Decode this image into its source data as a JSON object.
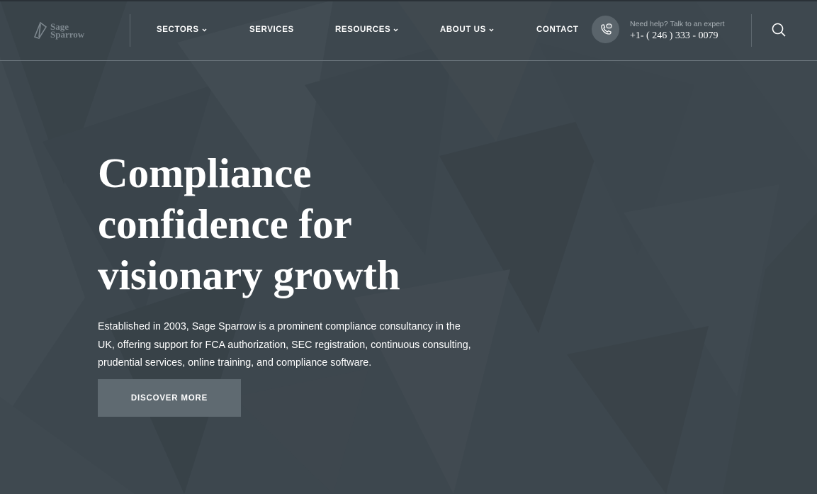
{
  "brand": {
    "line1": "Sage",
    "line2": "Sparrow"
  },
  "nav": {
    "items": [
      {
        "label": "SECTORS",
        "dropdown": true
      },
      {
        "label": "SERVICES",
        "dropdown": false
      },
      {
        "label": "RESOURCES",
        "dropdown": true
      },
      {
        "label": "ABOUT US",
        "dropdown": true
      },
      {
        "label": "CONTACT",
        "dropdown": false
      }
    ]
  },
  "help": {
    "label": "Need help? Talk to an expert",
    "phone": "+1- ( 246 ) 333 - 0079",
    "icon": "phone-chat-icon"
  },
  "search": {
    "icon": "search-icon"
  },
  "hero": {
    "title_lines": [
      "Compliance",
      "confidence for",
      "visionary growth"
    ],
    "description_lines": [
      "Established in 2003, Sage Sparrow is a prominent compliance consultancy in the",
      "UK, offering support for FCA authorization, SEC registration, continuous consulting,",
      "prudential services, online training, and compliance software."
    ],
    "cta_label": "DISCOVER MORE"
  },
  "colors": {
    "background": "#3d474e",
    "button": "#5f6a71",
    "help_circle": "#5a646b",
    "text": "#ffffff"
  }
}
